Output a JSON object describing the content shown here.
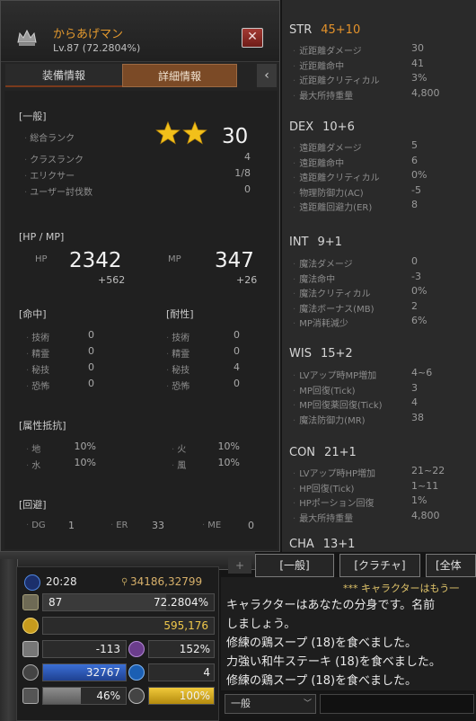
{
  "character": {
    "name": "からあげマン",
    "level": "Lv.87 (72.2804%)",
    "close": "✕"
  },
  "tabs": [
    {
      "label": "装備情報"
    },
    {
      "label": "詳細情報"
    }
  ],
  "tab_arrow": "‹",
  "general": {
    "title": "[一般]",
    "rank_label": "総合ランク",
    "rank_value": "30",
    "rank_stars": 2,
    "class_rank_label": "クラスランク",
    "class_rank_value": "4",
    "elixir_label": "エリクサー",
    "elixir_value": "1/8",
    "user_kills_label": "ユーザー討伐数",
    "user_kills_value": "0"
  },
  "hpmp": {
    "title": "[HP / MP]",
    "hp_label": "HP",
    "hp_value": "2342",
    "hp_bonus": "+562",
    "mp_label": "MP",
    "mp_value": "347",
    "mp_bonus": "+26"
  },
  "hit": {
    "title": "[命中]",
    "rows": [
      {
        "label": "技術",
        "value": "0"
      },
      {
        "label": "精霊",
        "value": "0"
      },
      {
        "label": "秘技",
        "value": "0"
      },
      {
        "label": "恐怖",
        "value": "0"
      }
    ]
  },
  "resist": {
    "title": "[耐性]",
    "rows": [
      {
        "label": "技術",
        "value": "0"
      },
      {
        "label": "精霊",
        "value": "0"
      },
      {
        "label": "秘技",
        "value": "4"
      },
      {
        "label": "恐怖",
        "value": "0"
      }
    ]
  },
  "element": {
    "title": "[属性抵抗]",
    "rows": [
      {
        "label": "地",
        "value": "10%"
      },
      {
        "label": "水",
        "value": "10%"
      },
      {
        "label": "火",
        "value": "10%"
      },
      {
        "label": "風",
        "value": "10%"
      }
    ]
  },
  "evasion": {
    "title": "[回避]",
    "dg_label": "DG",
    "dg_value": "1",
    "er_label": "ER",
    "er_value": "33",
    "me_label": "ME",
    "me_value": "0"
  },
  "stat_groups": [
    {
      "name": "STR",
      "value": "45+10",
      "highlight": true,
      "rows": [
        {
          "label": "近距離ダメージ",
          "value": "30"
        },
        {
          "label": "近距離命中",
          "value": "41"
        },
        {
          "label": "近距離クリティカル",
          "value": "3%"
        },
        {
          "label": "最大所持重量",
          "value": "4,800"
        }
      ]
    },
    {
      "name": "DEX",
      "value": "10+6",
      "highlight": false,
      "rows": [
        {
          "label": "遠距離ダメージ",
          "value": "5"
        },
        {
          "label": "遠距離命中",
          "value": "6"
        },
        {
          "label": "遠距離クリティカル",
          "value": "0%"
        },
        {
          "label": "物理防御力(AC)",
          "value": "-5"
        },
        {
          "label": "遠距離回避力(ER)",
          "value": "8"
        }
      ]
    },
    {
      "name": "INT",
      "value": "9+1",
      "highlight": false,
      "rows": [
        {
          "label": "魔法ダメージ",
          "value": "0"
        },
        {
          "label": "魔法命中",
          "value": "-3"
        },
        {
          "label": "魔法クリティカル",
          "value": "0%"
        },
        {
          "label": "魔法ボーナス(MB)",
          "value": "2"
        },
        {
          "label": "MP消耗減少",
          "value": "6%"
        }
      ]
    },
    {
      "name": "WIS",
      "value": "15+2",
      "highlight": false,
      "rows": [
        {
          "label": "LVアップ時MP増加",
          "value": "4~6"
        },
        {
          "label": "MP回復(Tick)",
          "value": "3"
        },
        {
          "label": "MP回復薬回復(Tick)",
          "value": "4"
        },
        {
          "label": "魔法防御力(MR)",
          "value": "38"
        }
      ]
    },
    {
      "name": "CON",
      "value": "21+1",
      "highlight": false,
      "rows": [
        {
          "label": "LVアップ時HP増加",
          "value": "21~22"
        },
        {
          "label": "HP回復(Tick)",
          "value": "1~11"
        },
        {
          "label": "HPポーション回復",
          "value": "1%"
        },
        {
          "label": "最大所持重量",
          "value": "4,800"
        }
      ]
    },
    {
      "name": "CHA",
      "value": "13+1",
      "highlight": false,
      "rows": []
    }
  ],
  "status": {
    "time": "20:28",
    "coords": "34186,32799",
    "level": "87",
    "exp": "72.2804%",
    "adena": "595,176",
    "ac": "-113",
    "mr": "152%",
    "hp": "32767",
    "sp": "4",
    "weight": "46%",
    "weight_fill": 0.46,
    "food": "100%",
    "food_fill": 1.0
  },
  "chat": {
    "tabs": [
      "[一般]",
      "[クラチャ]",
      "[全体"
    ],
    "plus": "+",
    "lines": [
      "*** キャラクターはもう一",
      "キャラクターはあなたの分身です。名前",
      " しましょう。",
      "修練の鶏スープ (18)を食べました。",
      "力強い和牛ステーキ (18)を食べました。",
      "修練の鶏スープ (18)を食べました。"
    ],
    "channel": "一般",
    "channel_arrow": "﹀"
  },
  "colors": {
    "accent_orange": "#e5932b",
    "name_color": "#e59a2e",
    "star": "#f2c01a",
    "hp_bar": "#2f5fbf",
    "food_bar": "#d9b21c",
    "weight_bar": "#7a7a7a"
  }
}
